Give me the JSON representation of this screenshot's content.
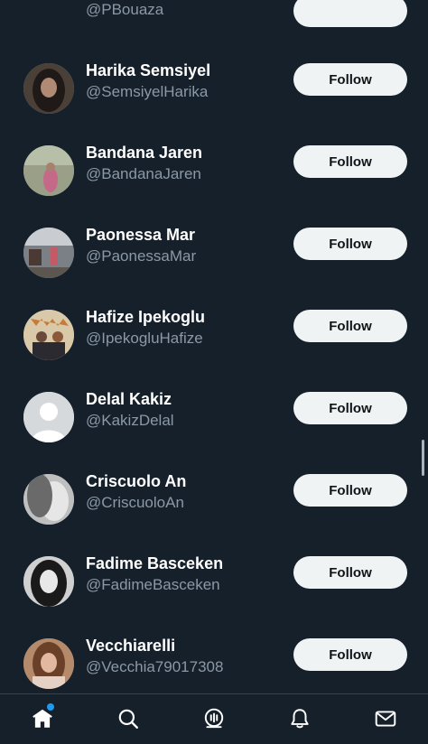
{
  "colors": {
    "background": "#15202b",
    "follow_button_bg": "#eff3f4",
    "follow_button_text": "#0f1419",
    "name_text": "#ffffff",
    "handle_text": "#8b98a5",
    "notification_dot": "#1d9bf0"
  },
  "users": [
    {
      "name": "",
      "handle": "@PBouaza",
      "button": ""
    },
    {
      "name": "Harika Semsiyel",
      "handle": "@SemsiyelHarika",
      "button": "Follow"
    },
    {
      "name": "Bandana Jaren",
      "handle": "@BandanaJaren",
      "button": "Follow"
    },
    {
      "name": "Paonessa Mar",
      "handle": "@PaonessaMar",
      "button": "Follow"
    },
    {
      "name": "Hafize Ipekoglu",
      "handle": "@IpekogluHafize",
      "button": "Follow"
    },
    {
      "name": "Delal Kakiz",
      "handle": "@KakizDelal",
      "button": "Follow"
    },
    {
      "name": "Criscuolo An",
      "handle": "@CriscuoloAn",
      "button": "Follow"
    },
    {
      "name": "Fadime Basceken",
      "handle": "@FadimeBasceken",
      "button": "Follow"
    },
    {
      "name": "Vecchiarelli",
      "handle": "@Vecchia79017308",
      "button": "Follow"
    }
  ],
  "tabbar": {
    "tabs": [
      {
        "icon": "home-icon",
        "active": true,
        "has_dot": true
      },
      {
        "icon": "search-icon",
        "active": false
      },
      {
        "icon": "spaces-icon",
        "active": false
      },
      {
        "icon": "notifications-icon",
        "active": false
      },
      {
        "icon": "messages-icon",
        "active": false
      }
    ]
  }
}
